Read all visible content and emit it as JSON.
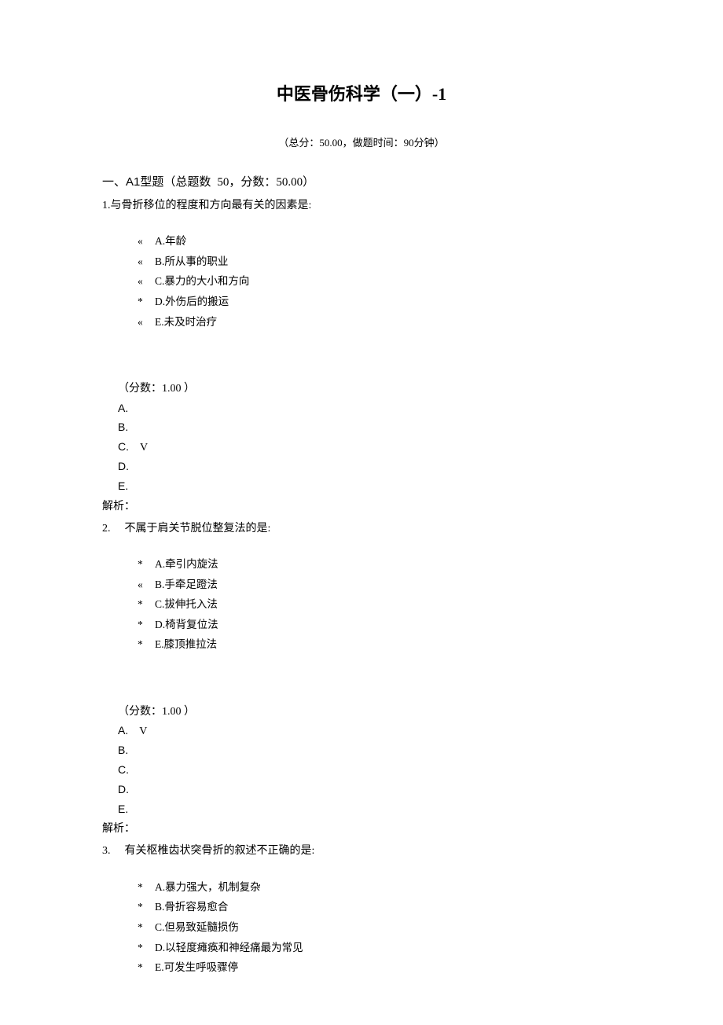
{
  "title": "中医骨伤科学（一）-1",
  "subtitle": "（总分：50.00，做题时间：90分钟）",
  "section": {
    "prefix": "一、",
    "type": "A1型题",
    "count_label": "（总题数",
    "count_value": "50，分数：50.00）"
  },
  "questions": [
    {
      "num": "1.",
      "stem": "与骨折移位的程度和方向最有关的因素是:",
      "options": [
        {
          "bullet": "«",
          "text": "A.年龄"
        },
        {
          "bullet": "«",
          "text": "B.所从事的职业"
        },
        {
          "bullet": "«",
          "text": "C.暴力的大小和方向"
        },
        {
          "bullet": "*",
          "text": "D.外伤后的搬运"
        },
        {
          "bullet": "«",
          "text": "E.未及时治疗"
        }
      ],
      "score": "（分数：1.00 ）",
      "answers": [
        {
          "label": "A.",
          "mark": ""
        },
        {
          "label": "B.",
          "mark": ""
        },
        {
          "label": "C.",
          "mark": "V"
        },
        {
          "label": "D.",
          "mark": ""
        },
        {
          "label": "E.",
          "mark": ""
        }
      ],
      "analysis": "解析："
    },
    {
      "num": "2.",
      "stem": "不属于肩关节脱位整复法的是:",
      "options": [
        {
          "bullet": "*",
          "text": "A.牵引内旋法"
        },
        {
          "bullet": "«",
          "text": "B.手牵足蹬法"
        },
        {
          "bullet": "*",
          "text": "C.拔伸托入法"
        },
        {
          "bullet": "*",
          "text": "D.椅背复位法"
        },
        {
          "bullet": "*",
          "text": "E.膝顶推拉法"
        }
      ],
      "score": "（分数：1.00 ）",
      "answers": [
        {
          "label": "A.",
          "mark": "V"
        },
        {
          "label": "B.",
          "mark": ""
        },
        {
          "label": "C.",
          "mark": ""
        },
        {
          "label": "D.",
          "mark": ""
        },
        {
          "label": "E.",
          "mark": ""
        }
      ],
      "analysis": "解析："
    },
    {
      "num": "3.",
      "stem": "有关枢椎齿状突骨折的叙述不正确的是:",
      "options": [
        {
          "bullet": "*",
          "text": "A.暴力强大，机制复杂"
        },
        {
          "bullet": "*",
          "text": "B.骨折容易愈合"
        },
        {
          "bullet": "*",
          "text": "C.但易致延髓损伤"
        },
        {
          "bullet": "*",
          "text": "D.以轻度瘫痪和神经痛最为常见"
        },
        {
          "bullet": "*",
          "text": "E.可发生呼吸骤停"
        }
      ],
      "score": "",
      "answers": [],
      "analysis": ""
    }
  ]
}
